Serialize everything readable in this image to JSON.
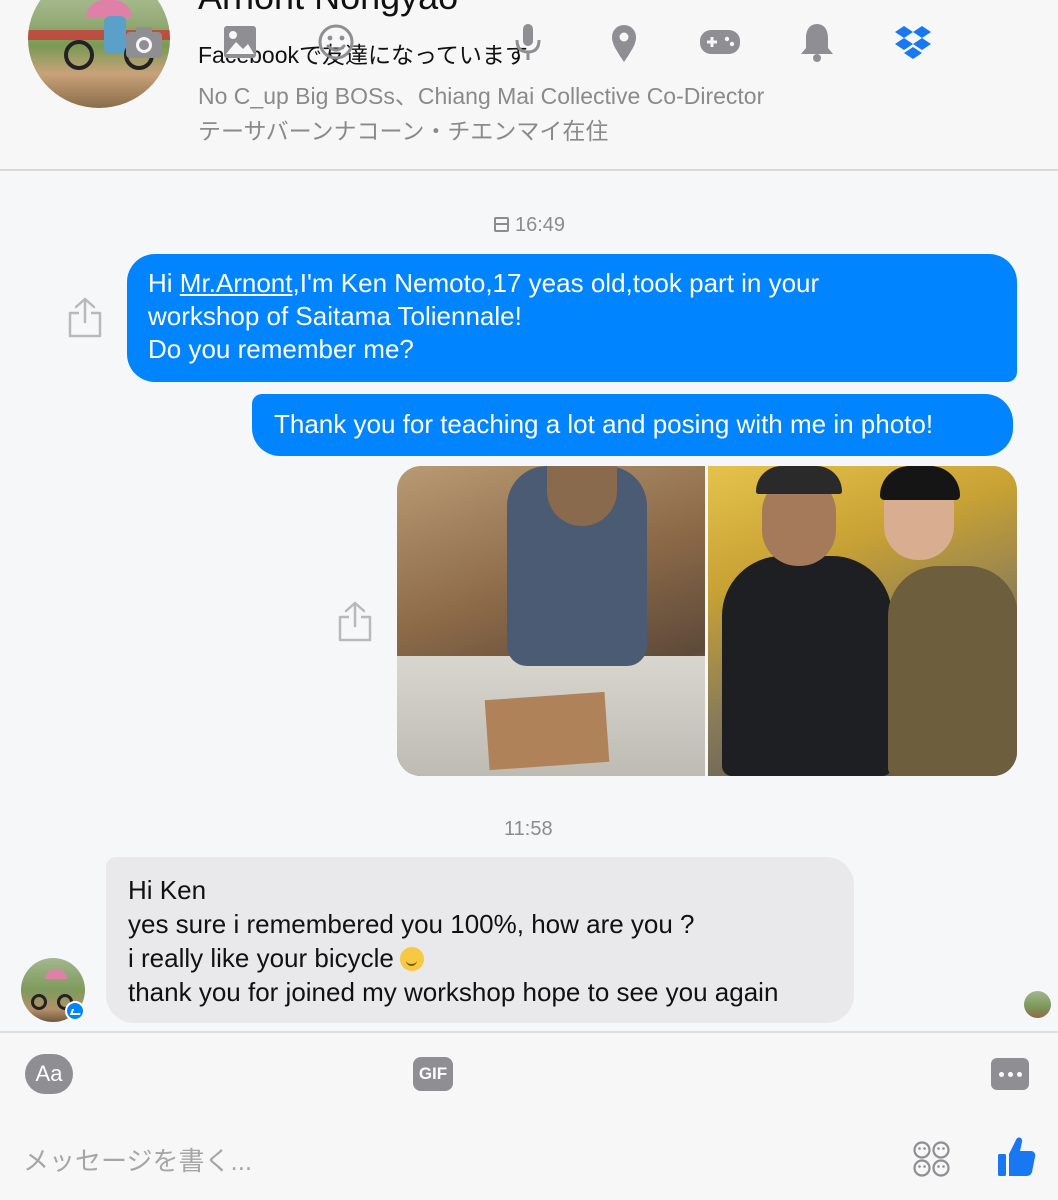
{
  "profile": {
    "name": "Arnont Nongyao",
    "friend_status": "Facebookで友達になっています",
    "work": "No C_up Big BOSs、Chiang Mai Collective Co-Director",
    "location": "テーサバーンナコーン・チエンマイ在住"
  },
  "conversation": {
    "timestamp_1": "日 16:49",
    "timestamp_1_time": "16:49",
    "outgoing": [
      {
        "prefix": "Hi ",
        "mention": "Mr.Arnont",
        "line1_rest": ",I'm Ken Nemoto,17 yeas old,took part in your",
        "line2": "workshop of Saitama Toliennale!",
        "line3": "Do you remember me?"
      },
      {
        "text": "Thank you for teaching a lot and posing with me in photo!"
      }
    ],
    "photos": [
      {
        "icon": "photo-workshop"
      },
      {
        "icon": "photo-selfie"
      }
    ],
    "timestamp_2": "11:58",
    "incoming": {
      "lines": [
        "Hi Ken",
        "yes sure i remembered you 100%, how are you ?",
        "i really like your bicycle",
        "thank you for joined my workshop hope to see you again"
      ],
      "emoji": "slightly-smiling-face"
    }
  },
  "composer": {
    "aa_label": "Aa",
    "gif_label": "GIF",
    "placeholder": "メッセージを書く...",
    "icons": [
      "text-format-icon",
      "camera-icon",
      "gallery-icon",
      "emoji-icon",
      "gif-icon",
      "microphone-icon",
      "location-icon",
      "game-controller-icon",
      "bell-icon",
      "dropbox-icon",
      "more-icon",
      "stickers-icon",
      "like-icon"
    ]
  },
  "colors": {
    "outgoing_bubble": "#0084ff",
    "incoming_bubble": "#e9e9eb",
    "icon_gray": "#8e8e93",
    "accent_blue": "#1877f2"
  }
}
